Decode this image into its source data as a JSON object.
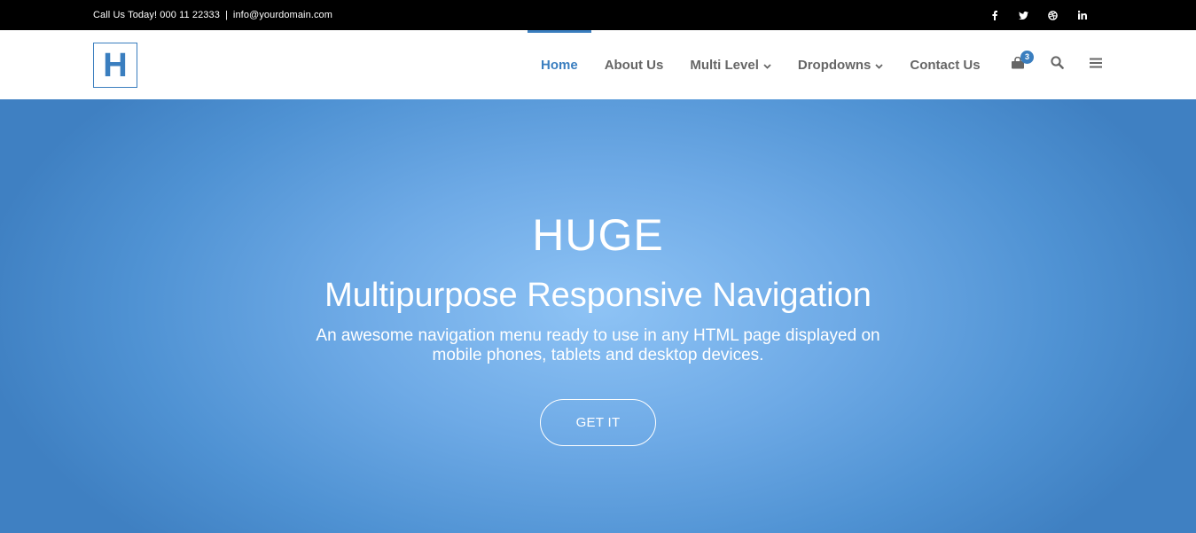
{
  "topbar": {
    "phone_text": "Call Us Today! 000 11 22333",
    "separator": "|",
    "email": "info@yourdomain.com",
    "social": [
      {
        "icon": "facebook-icon",
        "glyph": "f"
      },
      {
        "icon": "twitter-icon",
        "glyph": "t"
      },
      {
        "icon": "dribbble-icon",
        "glyph": "d"
      },
      {
        "icon": "linkedin-icon",
        "glyph": "in"
      }
    ]
  },
  "header": {
    "logo_letter": "H",
    "nav": [
      {
        "label": "Home",
        "active": true,
        "dropdown": false
      },
      {
        "label": "About Us",
        "active": false,
        "dropdown": false
      },
      {
        "label": "Multi Level",
        "active": false,
        "dropdown": true
      },
      {
        "label": "Dropdowns",
        "active": false,
        "dropdown": true
      },
      {
        "label": "Contact Us",
        "active": false,
        "dropdown": false
      }
    ],
    "cart_count": "3",
    "icons": [
      "shopping-bag-icon",
      "search-icon",
      "menu-icon"
    ]
  },
  "hero": {
    "title": "HUGE",
    "subtitle": "Multipurpose Responsive Navigation",
    "desc_line1": "An awesome navigation menu ready to use in any HTML page displayed on",
    "desc_line2": "mobile phones, tablets and desktop devices.",
    "cta_label": "GET IT"
  },
  "colors": {
    "accent": "#3a7ebf",
    "topbar_bg": "#000000",
    "nav_text": "#666666"
  }
}
